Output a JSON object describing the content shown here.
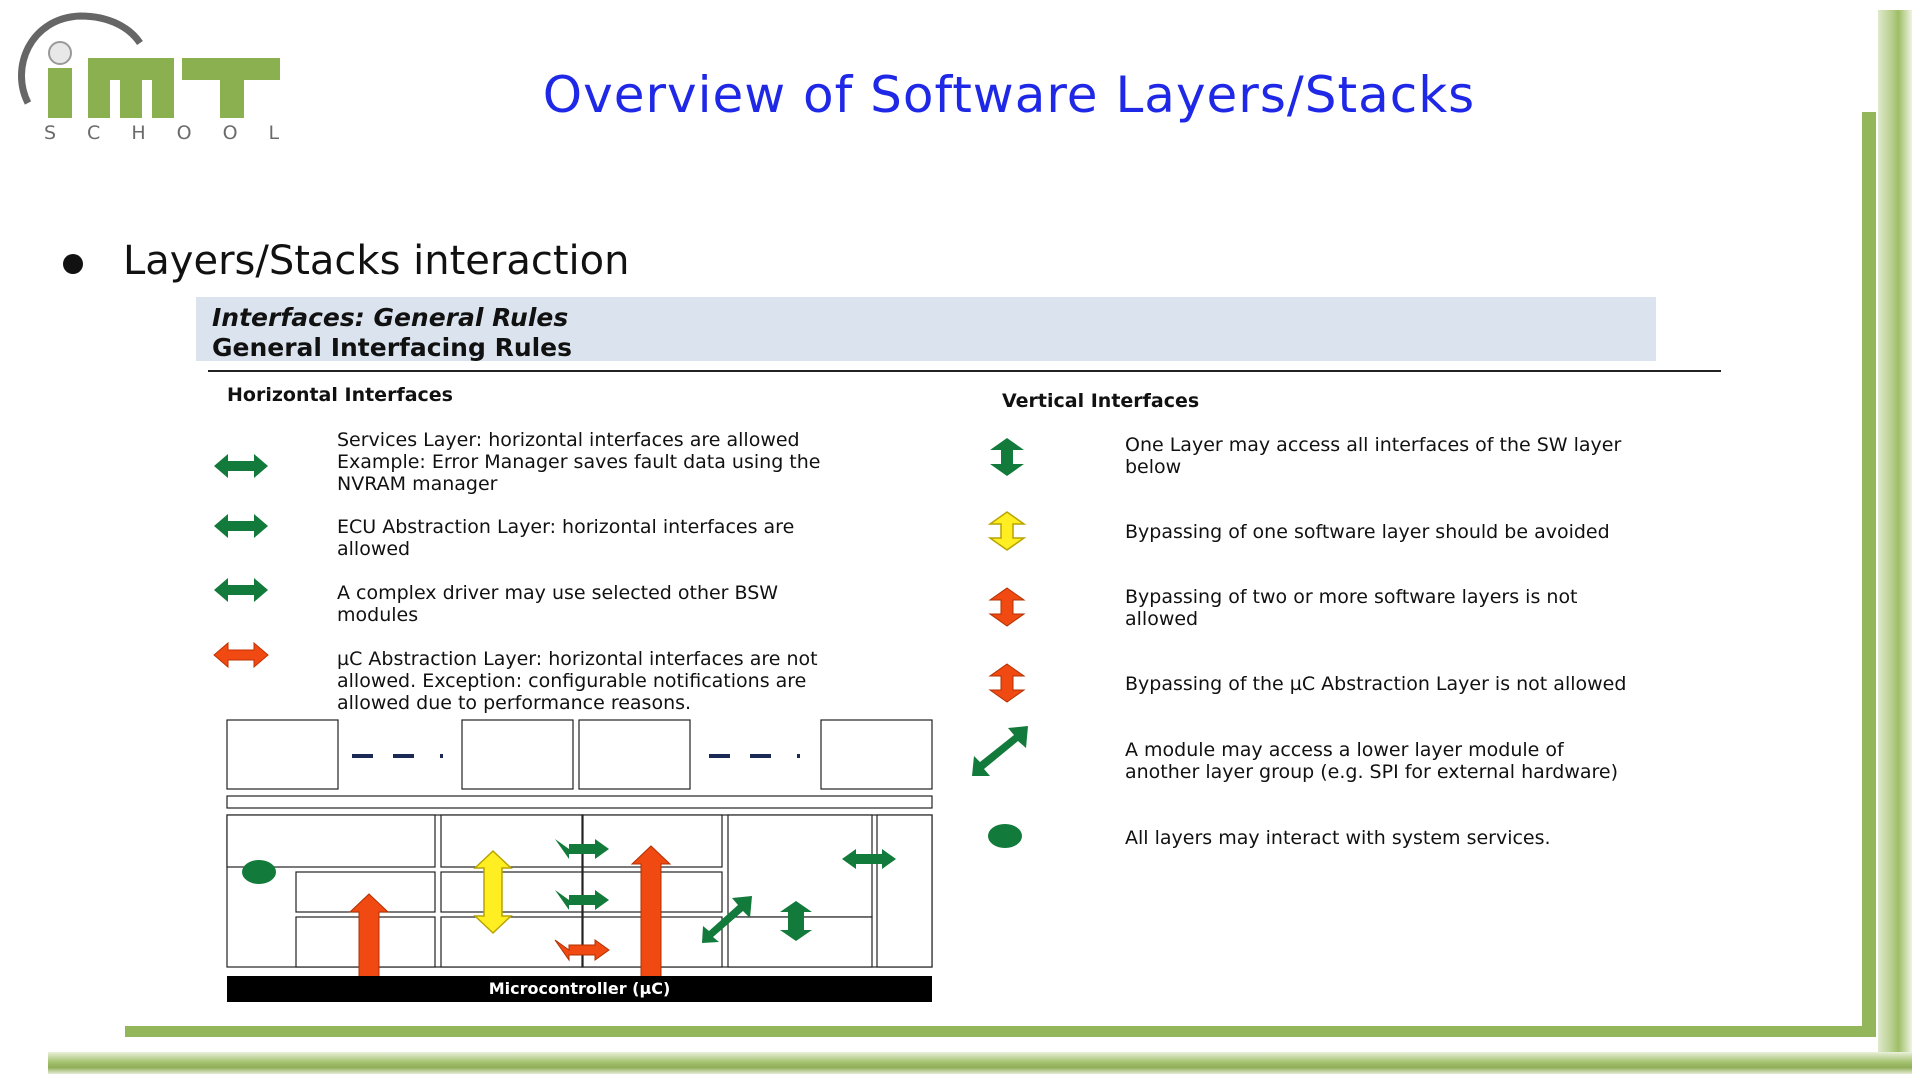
{
  "logo": {
    "brand": "IMT",
    "subtitle": "SCHOOL"
  },
  "title": "Overview of Software Layers/Stacks",
  "bullet": "Layers/Stacks interaction",
  "header": {
    "line1": "Interfaces: General Rules",
    "line2": "General Interfacing Rules"
  },
  "horizontal": {
    "heading": "Horizontal Interfaces",
    "items": [
      {
        "icon": "green-horizontal-arrow-icon",
        "text": "Services Layer: horizontal interfaces are allowed\nExample: Error Manager saves fault data using the\nNVRAM manager"
      },
      {
        "icon": "green-horizontal-arrow-icon",
        "text": "ECU Abstraction Layer: horizontal interfaces are\nallowed"
      },
      {
        "icon": "green-horizontal-arrow-icon",
        "text": "A complex driver may use selected other BSW\nmodules"
      },
      {
        "icon": "orange-horizontal-arrow-icon",
        "text": "µC Abstraction Layer: horizontal interfaces are not\nallowed. Exception: configurable notifications are\nallowed due to performance reasons."
      }
    ]
  },
  "vertical": {
    "heading": "Vertical Interfaces",
    "items": [
      {
        "icon": "green-vertical-arrow-icon",
        "text": "One Layer may access all interfaces of the SW layer\nbelow"
      },
      {
        "icon": "yellow-vertical-arrow-icon",
        "text": "Bypassing of one software layer should be avoided"
      },
      {
        "icon": "orange-vertical-arrow-icon",
        "text": "Bypassing of two or more software layers is not\nallowed"
      },
      {
        "icon": "orange-vertical-arrow-icon",
        "text": "Bypassing of the µC Abstraction Layer is not allowed"
      },
      {
        "icon": "green-diagonal-arrow-icon",
        "text": "A module may access a lower layer module of\nanother layer group (e.g. SPI for external hardware)"
      },
      {
        "icon": "green-dot-icon",
        "text": "All layers may interact with system services."
      }
    ]
  },
  "diagram": {
    "microcontroller_label": "Microcontroller (µC)"
  },
  "colors": {
    "title": "#1e28e6",
    "green": "#127a3a",
    "orange": "#f04a12",
    "yellow": "#ffee22",
    "frame": "#93b65a",
    "header_bg": "#dbe4ee"
  }
}
